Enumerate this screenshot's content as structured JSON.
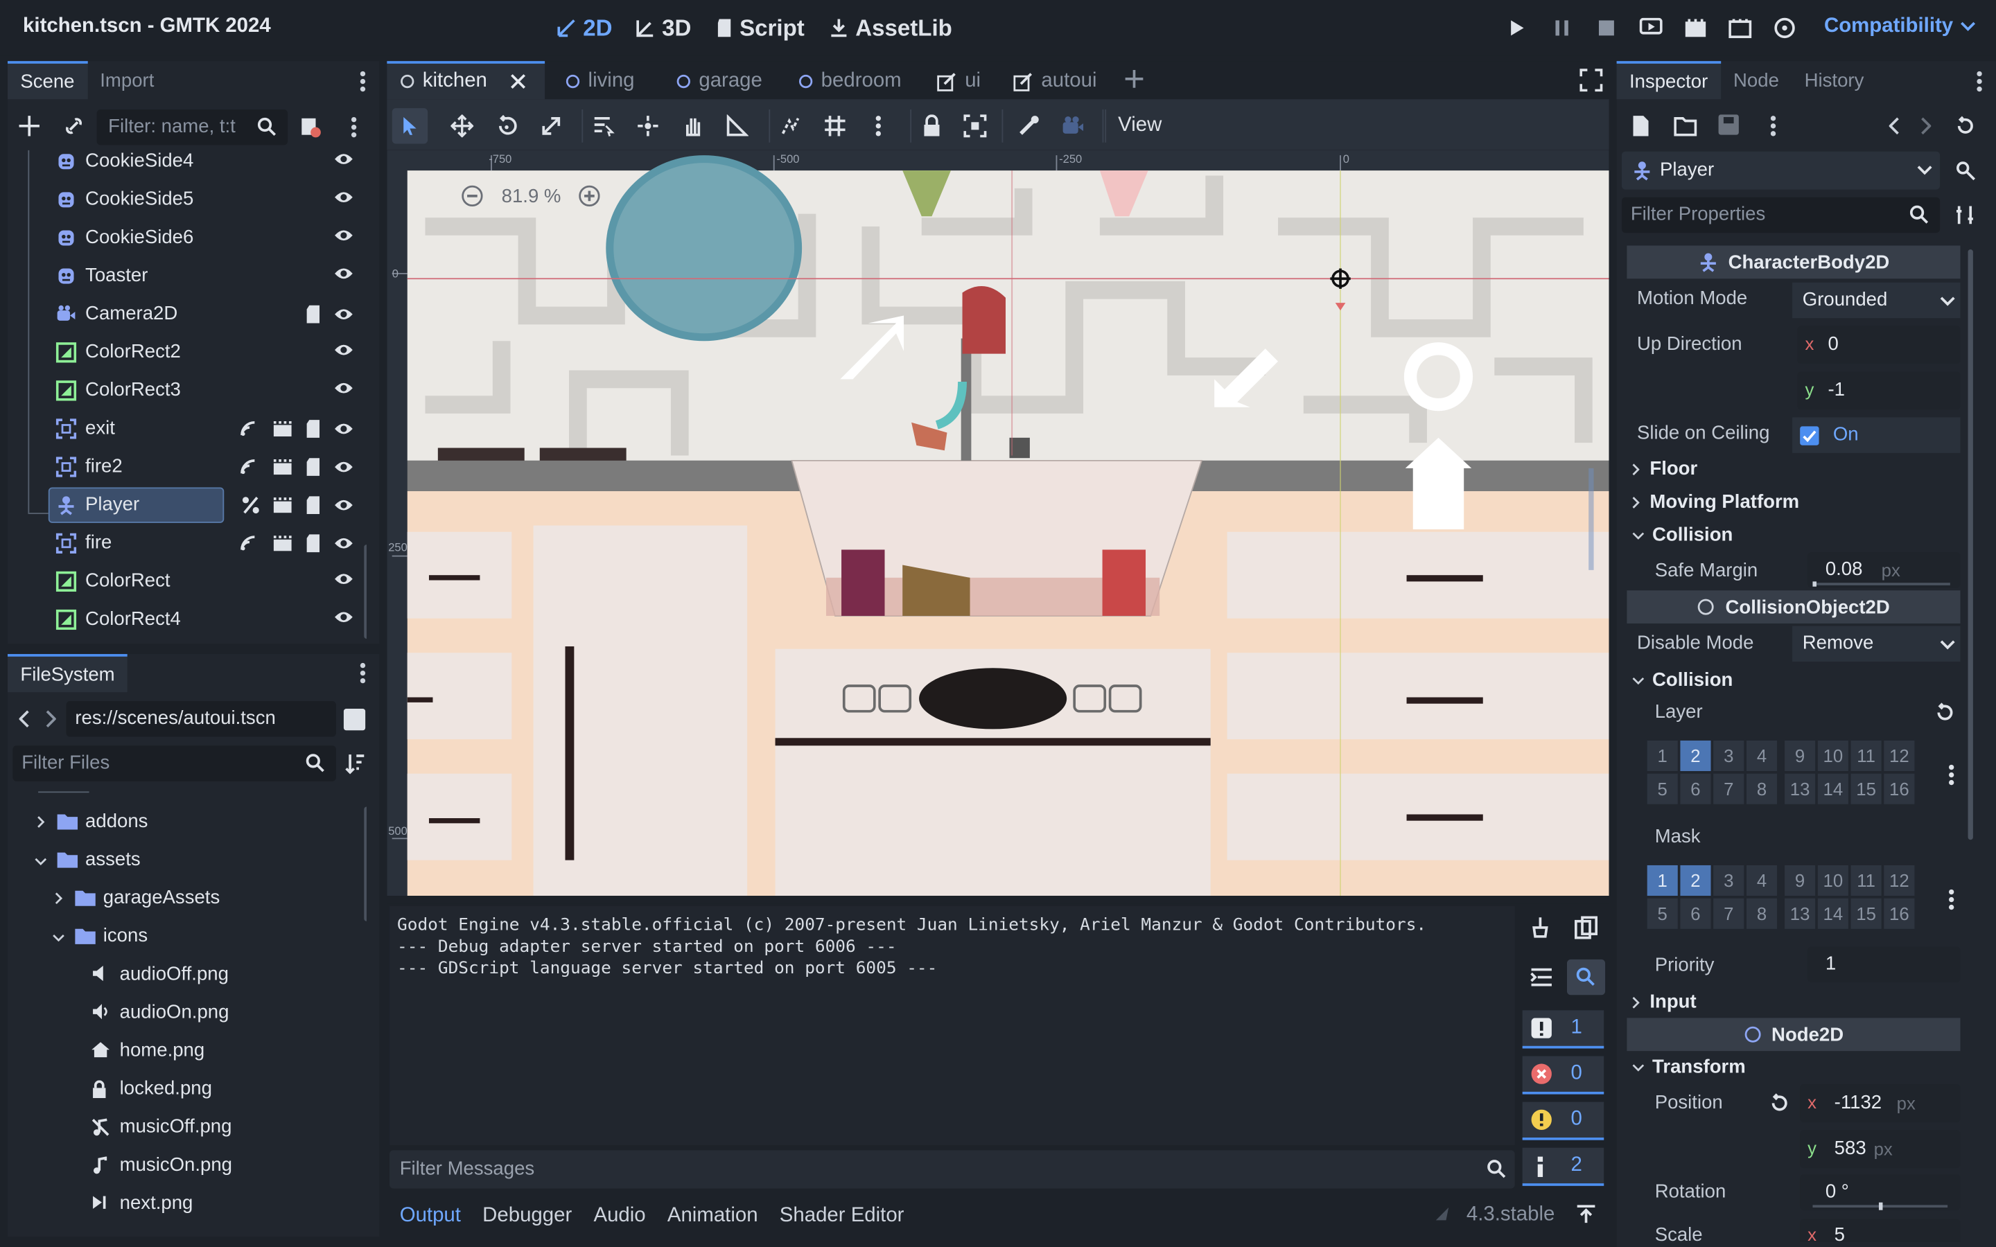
{
  "window": {
    "title": "kitchen.tscn - GMTK 2024"
  },
  "workspaces": [
    {
      "label": "2D"
    },
    {
      "label": "3D"
    },
    {
      "label": "Script"
    },
    {
      "label": "AssetLib"
    }
  ],
  "renderer": {
    "label": "Compatibility"
  },
  "scene_dock": {
    "tabs": [
      "Scene",
      "Import"
    ],
    "filter_placeholder": "Filter: name, t:t",
    "nodes": [
      "CookieSide4",
      "CookieSide5",
      "CookieSide6",
      "Toaster",
      "Camera2D",
      "ColorRect2",
      "ColorRect3",
      "exit",
      "fire2",
      "Player",
      "fire",
      "ColorRect",
      "ColorRect4"
    ]
  },
  "filesystem": {
    "tab": "FileSystem",
    "path": "res://scenes/autoui.tscn",
    "filter_placeholder": "Filter Files",
    "items": [
      "addons",
      "assets",
      "garageAssets",
      "icons",
      "audioOff.png",
      "audioOn.png",
      "home.png",
      "locked.png",
      "musicOff.png",
      "musicOn.png",
      "next.png"
    ]
  },
  "editor_tabs": [
    "kitchen",
    "living",
    "garage",
    "bedroom",
    "ui",
    "autoui"
  ],
  "toolbar": {
    "view_label": "View"
  },
  "viewport": {
    "zoom": "81.9 %",
    "ruler_top": [
      "-750",
      "-500",
      "-250",
      "0"
    ],
    "ruler_left": [
      "0",
      "250",
      "500"
    ]
  },
  "output": {
    "lines": [
      "Godot Engine v4.3.stable.official (c) 2007-present Juan Linietsky, Ariel Manzur & Godot Contributors.",
      "--- Debug adapter server started on port 6006 ---",
      "--- GDScript language server started on port 6005 ---"
    ],
    "filter_placeholder": "Filter Messages",
    "counts": [
      "1",
      "0",
      "0",
      "2"
    ],
    "tabs": [
      "Output",
      "Debugger",
      "Audio",
      "Animation",
      "Shader Editor"
    ],
    "version": "4.3.stable"
  },
  "inspector": {
    "tabs": [
      "Inspector",
      "Node",
      "History"
    ],
    "object": "Player",
    "filter_placeholder": "Filter Properties",
    "class1": "CharacterBody2D",
    "motion_mode_label": "Motion Mode",
    "motion_mode": "Grounded",
    "up_direction_label": "Up Direction",
    "up_x": "0",
    "up_y": "-1",
    "slide_label": "Slide on Ceiling",
    "slide_val": "On",
    "groups": [
      "Floor",
      "Moving Platform",
      "Collision"
    ],
    "safe_margin_label": "Safe Margin",
    "safe_margin": "0.08",
    "px": "px",
    "class2": "CollisionObject2D",
    "disable_mode_label": "Disable Mode",
    "disable_mode": "Remove",
    "collision_group": "Collision",
    "layer_label": "Layer",
    "mask_label": "Mask",
    "bits_top": [
      "1",
      "2",
      "3",
      "4",
      "9",
      "10",
      "11",
      "12"
    ],
    "bits_bottom": [
      "5",
      "6",
      "7",
      "8",
      "13",
      "14",
      "15",
      "16"
    ],
    "priority_label": "Priority",
    "priority": "1",
    "input_group": "Input",
    "class3": "Node2D",
    "transform_group": "Transform",
    "position_label": "Position",
    "pos_x": "-1132",
    "pos_y": "583",
    "rotation_label": "Rotation",
    "rotation": "0 °",
    "scale_label": "Scale",
    "scale_x": "5",
    "axis_x": "x",
    "axis_y": "y"
  },
  "colors": {
    "accent": "#4d8ff0",
    "node2d_icon": "#8da5f3",
    "control_icon": "#8eef97"
  }
}
